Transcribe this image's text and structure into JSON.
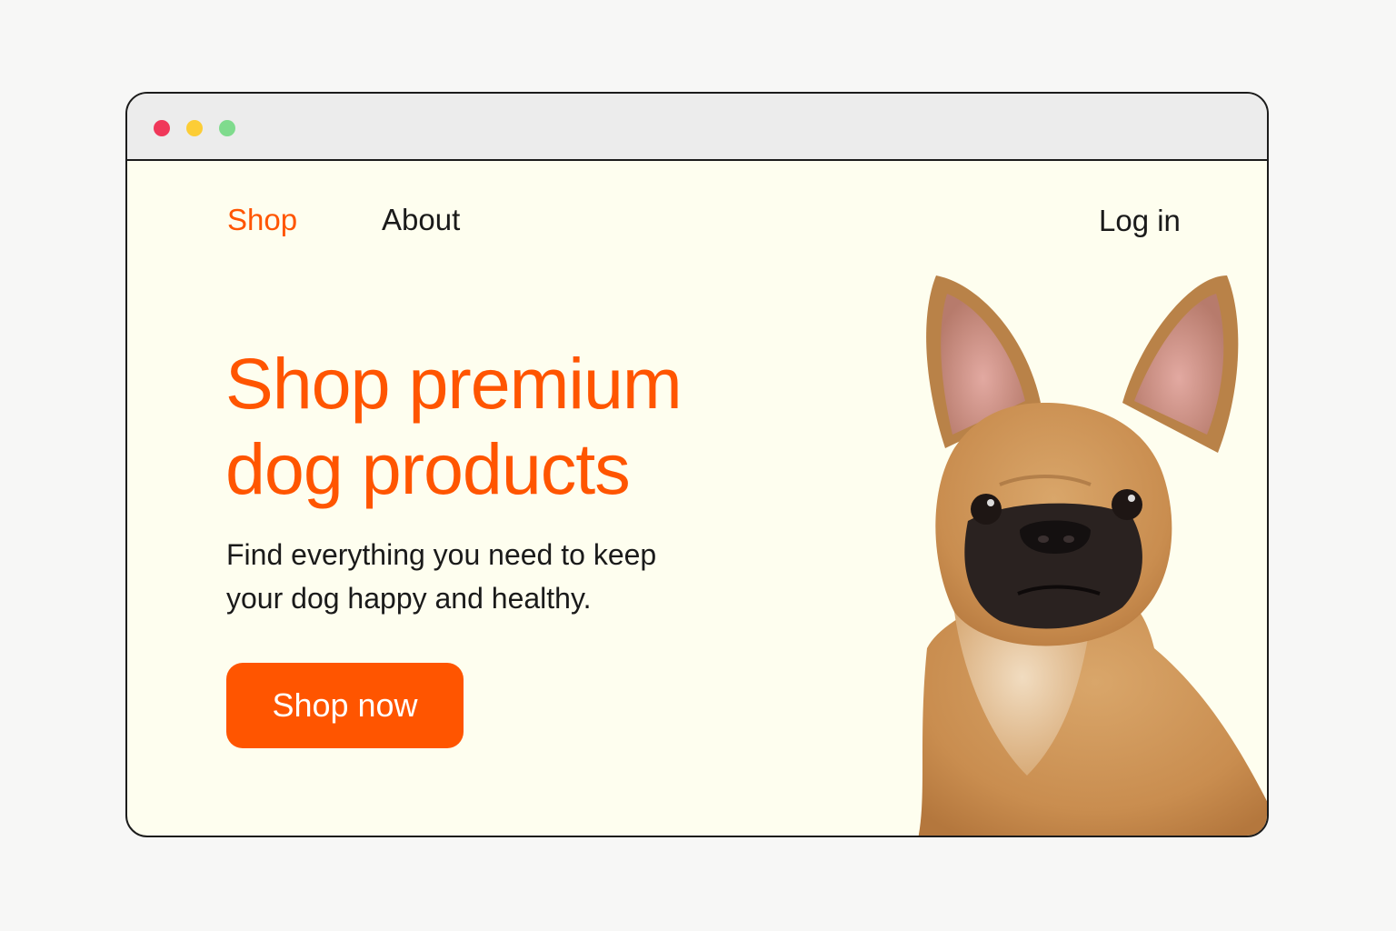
{
  "colors": {
    "accent": "#ff5500",
    "traffic_red": "#f0385a",
    "traffic_yellow": "#fccd36",
    "traffic_green": "#7fdb8d"
  },
  "nav": {
    "shop_label": "Shop",
    "about_label": "About",
    "login_label": "Log in"
  },
  "hero": {
    "title_line1": "Shop premium",
    "title_line2": "dog products",
    "subtitle_line1": "Find everything you need to keep",
    "subtitle_line2": "your dog happy and healthy.",
    "cta_label": "Shop now"
  },
  "image": {
    "subject": "french-bulldog-photo"
  }
}
